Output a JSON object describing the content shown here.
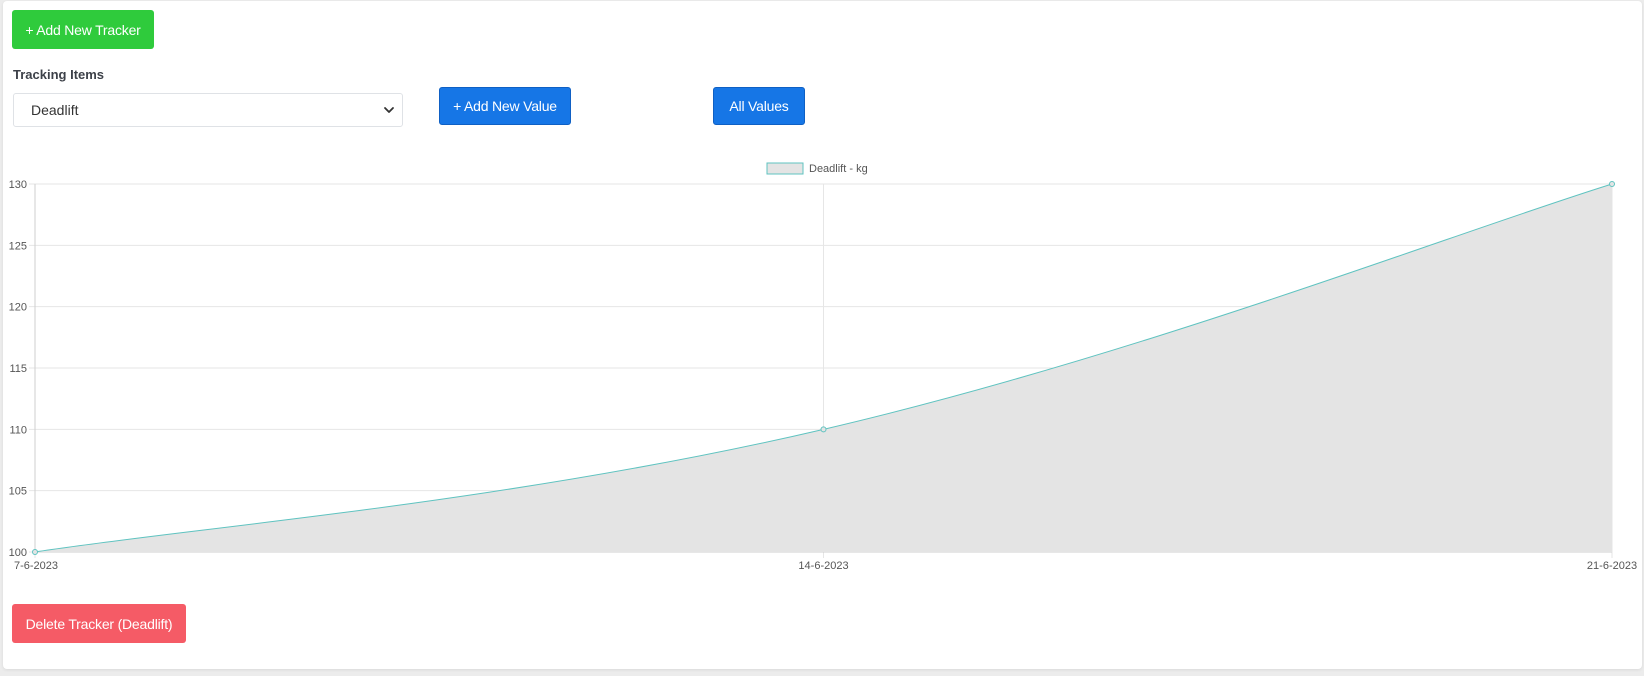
{
  "toolbar": {
    "add_tracker_label": "+ Add New Tracker"
  },
  "tracking": {
    "label": "Tracking Items",
    "selected": "Deadlift",
    "add_value_label": "+ Add New Value",
    "all_values_label": "All Values"
  },
  "footer": {
    "delete_label": "Delete Tracker (Deadlift)"
  },
  "colors": {
    "green": "#2fcb3c",
    "blue": "#1676e6",
    "red": "#f55b66",
    "line": "#5fc3c0",
    "fill": "#e4e4e4"
  },
  "chart_data": {
    "type": "area",
    "categories": [
      "7-6-2023",
      "14-6-2023",
      "21-6-2023"
    ],
    "series": [
      {
        "name": "Deadlift - kg",
        "values": [
          100,
          110,
          130
        ]
      }
    ],
    "ylim": [
      100,
      130
    ],
    "yticks": [
      100,
      105,
      110,
      115,
      120,
      125,
      130
    ],
    "grid": true,
    "legend": "top-center"
  }
}
